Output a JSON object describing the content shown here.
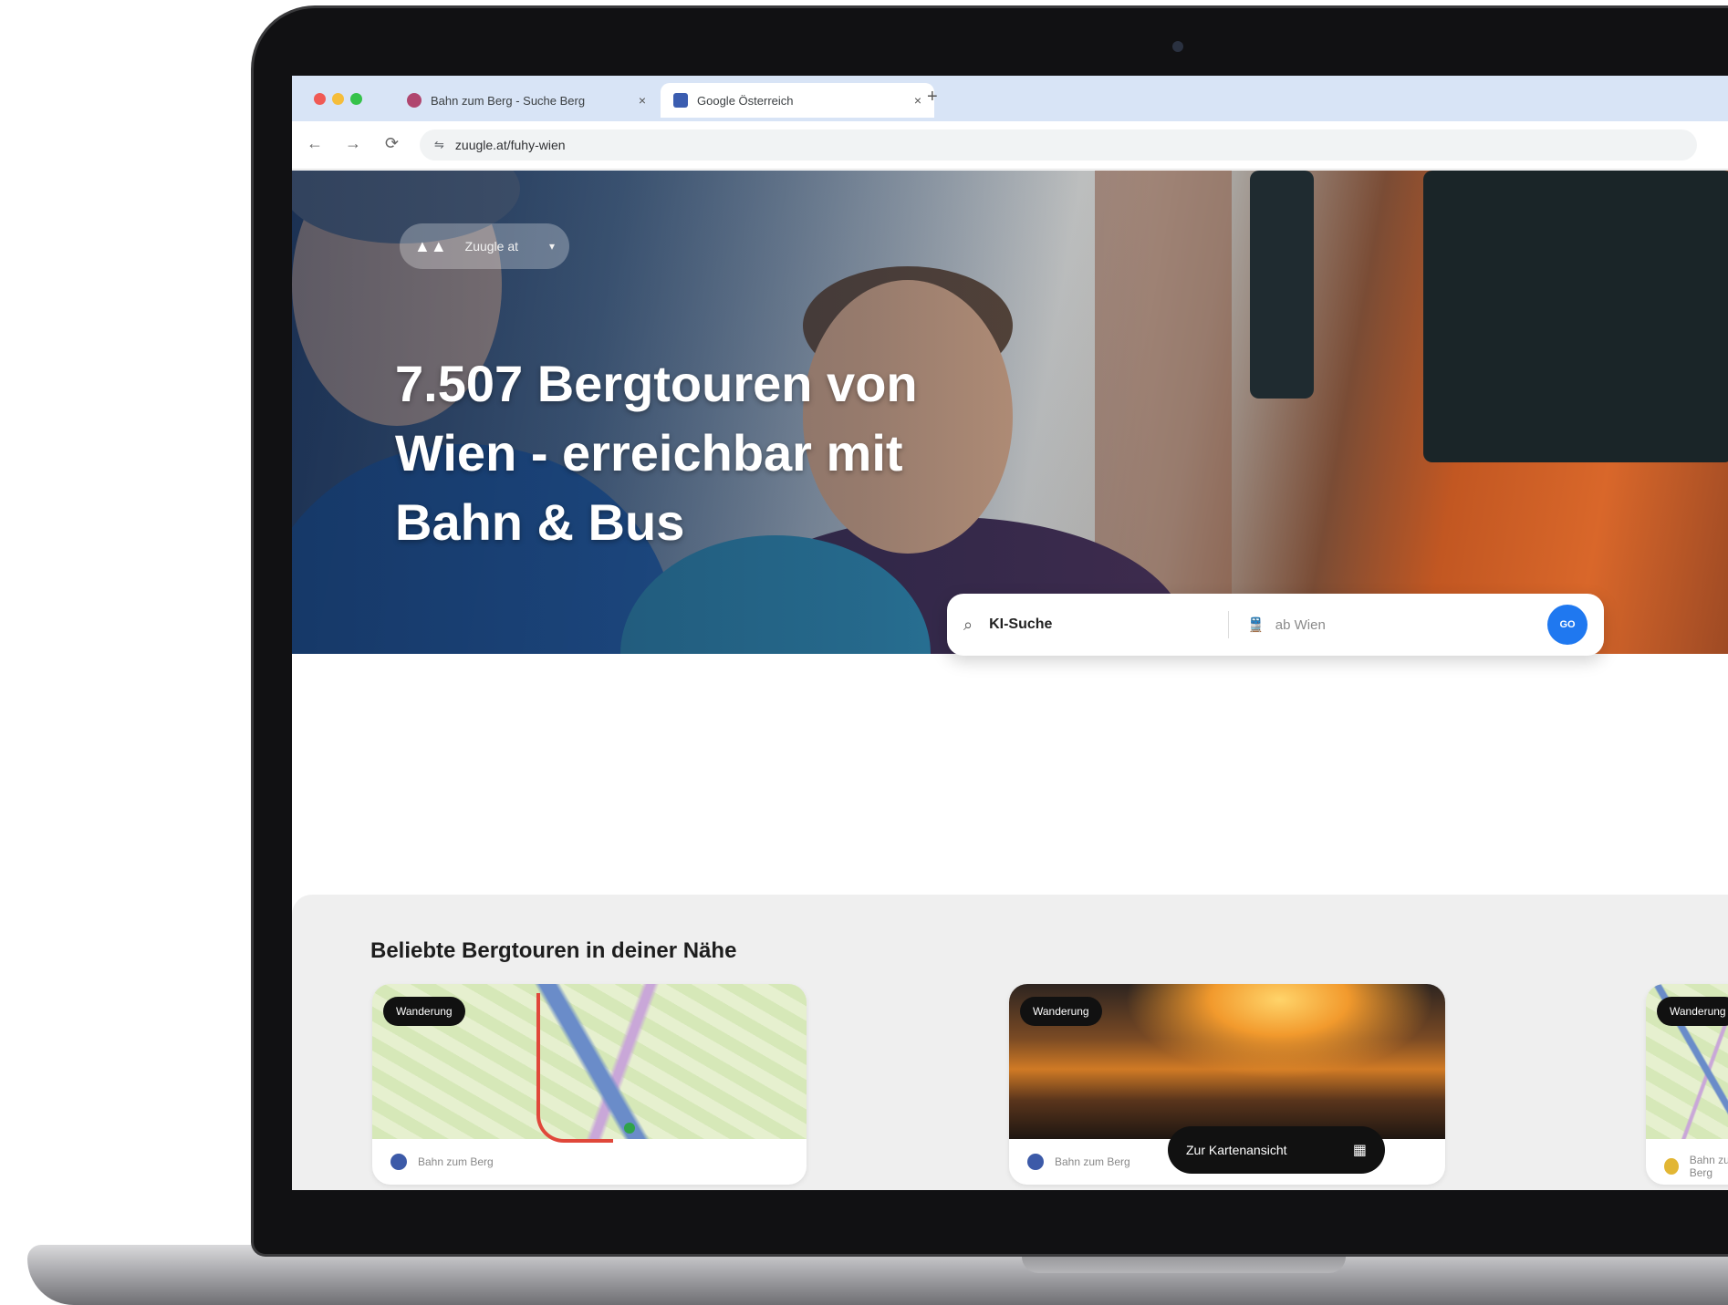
{
  "browser": {
    "tabs": [
      {
        "label": "Bahn zum Berg - Suche Berg",
        "close": "×"
      },
      {
        "label": "Google Österreich",
        "close": "×"
      }
    ],
    "new_tab": "+",
    "address": "zuugle.at/fuhy-wien",
    "nav": {
      "back": "←",
      "forward": "→",
      "reload": "⟳",
      "secure": "⇋"
    }
  },
  "hero": {
    "region_label": "Zuugle at",
    "region_chevron": "▾",
    "region_icon": "▲▲",
    "title": "7.507 Bergtouren von Wien - erreichbar mit Bahn & Bus"
  },
  "search": {
    "icon": "⌕",
    "query": "KI-Suche",
    "origin_icon": "🚆",
    "origin_placeholder": "ab Wien",
    "go_label": "GO"
  },
  "popular": {
    "title": "Beliebte Bergtouren in deiner Nähe",
    "cards": [
      {
        "badge": "Wanderung",
        "provider": "Bahn zum Berg"
      },
      {
        "badge": "Wanderung",
        "provider": "Bahn zum Berg"
      },
      {
        "badge": "Wanderung",
        "provider": "Bahn zum Berg"
      }
    ],
    "map_toggle": {
      "label": "Zur Kartenansicht",
      "icon": "▦"
    }
  }
}
